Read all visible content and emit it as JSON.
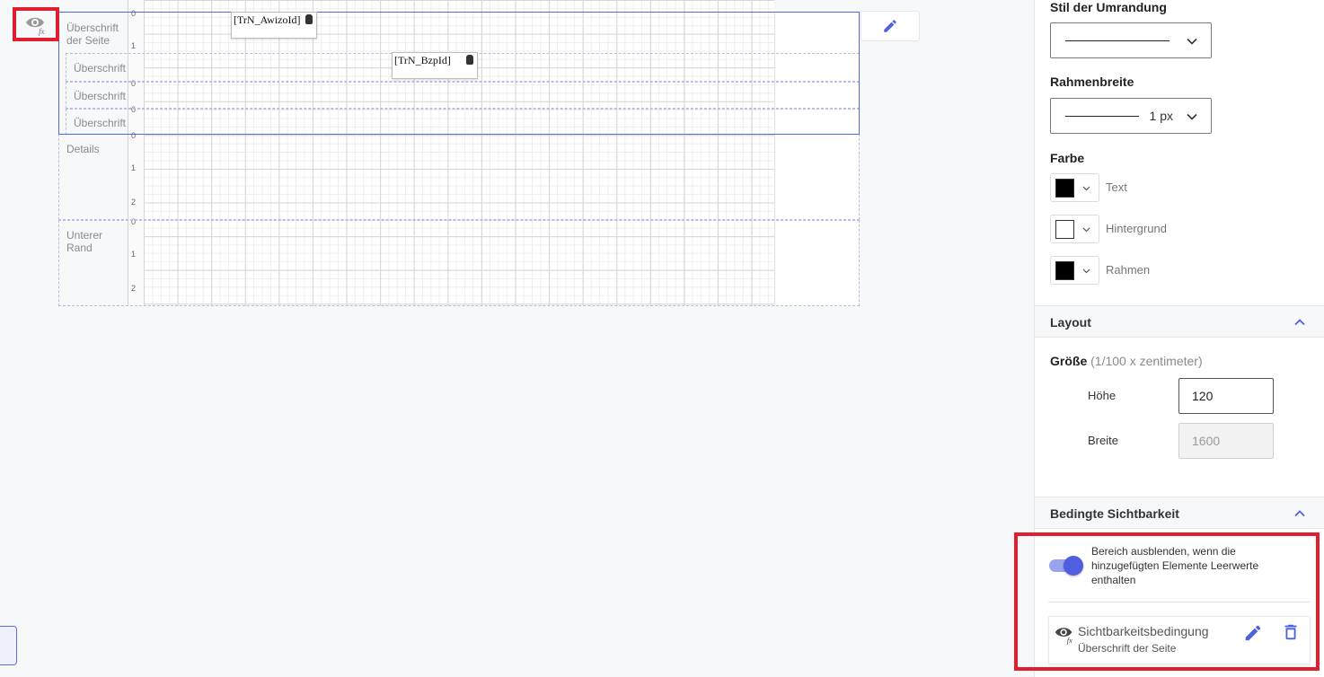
{
  "canvas": {
    "bands": [
      {
        "label": "Überschrift der Seite",
        "ruler": [
          "0",
          "1"
        ]
      },
      {
        "label": "Überschrift der",
        "ruler": [
          "0"
        ]
      },
      {
        "label": "Überschrift der",
        "ruler": [
          "0"
        ]
      },
      {
        "label": "Überschrift",
        "ruler": [
          "0"
        ]
      },
      {
        "label": "Details",
        "ruler": [
          "0",
          "1",
          "2"
        ]
      },
      {
        "label": "Unterer Rand",
        "ruler": [
          "0",
          "1",
          "2"
        ]
      }
    ],
    "fields": {
      "awizo": "[TrN_AwizoId]",
      "bzp": "[TrN_BzpId]"
    },
    "icons": {
      "visibility_toggle": "eye-fx-icon",
      "edit": "pencil-icon",
      "field_source": "database-icon"
    }
  },
  "panel": {
    "border_style": {
      "label": "Stil der Umrandung"
    },
    "border_width": {
      "label": "Rahmenbreite",
      "value": "1 px"
    },
    "color": {
      "label": "Farbe",
      "items": [
        {
          "name": "Text",
          "swatch": "#000000"
        },
        {
          "name": "Hintergrund",
          "swatch": "#ffffff"
        },
        {
          "name": "Rahmen",
          "swatch": "#000000"
        }
      ]
    },
    "layout": {
      "title": "Layout",
      "size_label": "Größe",
      "size_unit": "(1/100 x zentimeter)",
      "height_label": "Höhe",
      "height_value": "120",
      "width_label": "Breite",
      "width_value": "1600"
    },
    "visibility": {
      "title": "Bedingte Sichtbarkeit",
      "toggle_text": "Bereich ausblenden, wenn die hinzugefügten Elemente Leerwerte enthalten",
      "toggle_on": true,
      "condition_title": "Sichtbarkeitsbedingung",
      "condition_subtitle": "Überschrift der Seite"
    }
  },
  "colors": {
    "accent": "#4f5fe0",
    "selection": "#4f6bd6",
    "highlight": "#e01e2d"
  }
}
